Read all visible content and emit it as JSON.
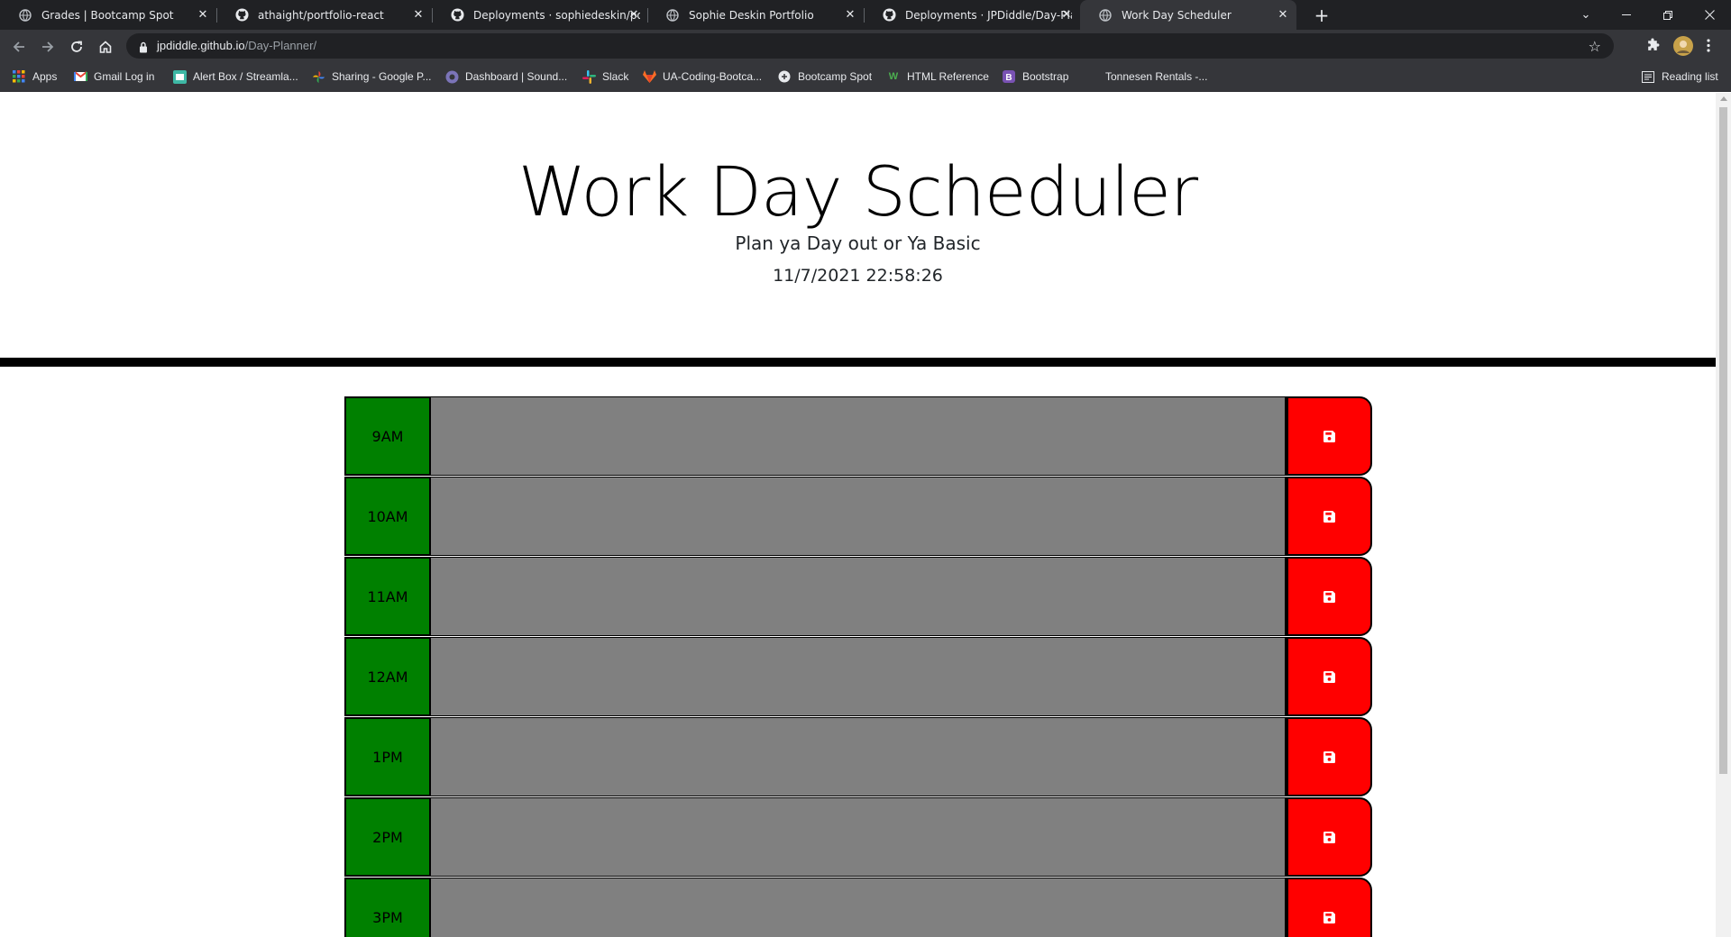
{
  "browser": {
    "tabs": [
      {
        "title": "Grades | Bootcamp Spot",
        "icon": "globe-icon"
      },
      {
        "title": "athaight/portfolio-react",
        "icon": "github-icon"
      },
      {
        "title": "Deployments · sophiedeskin/port",
        "icon": "github-icon"
      },
      {
        "title": "Sophie Deskin Portfolio",
        "icon": "globe-icon"
      },
      {
        "title": "Deployments · JPDiddle/Day-Plan",
        "icon": "github-icon"
      },
      {
        "title": "Work Day Scheduler",
        "icon": "globe-icon"
      }
    ],
    "active_tab": 5,
    "url_host": "jpdiddle.github.io",
    "url_path": "/Day-Planner/",
    "bookmarks": [
      {
        "label": "Apps",
        "icon": "apps-grid-icon"
      },
      {
        "label": "Gmail Log in",
        "icon": "gmail-icon"
      },
      {
        "label": "Alert Box / Streamla...",
        "icon": "alertbox-icon"
      },
      {
        "label": "Sharing - Google P...",
        "icon": "google-photos-icon"
      },
      {
        "label": "Dashboard | Sound...",
        "icon": "soundcloud-icon"
      },
      {
        "label": "Slack",
        "icon": "slack-icon"
      },
      {
        "label": "UA-Coding-Bootca...",
        "icon": "gitlab-icon"
      },
      {
        "label": "Bootcamp Spot",
        "icon": "globe-icon"
      },
      {
        "label": "HTML Reference",
        "icon": "w3-icon"
      },
      {
        "label": "Bootstrap",
        "icon": "bootstrap-icon"
      },
      {
        "label": "Tonnesen Rentals -...",
        "icon": "blank-icon"
      }
    ],
    "reading_list": "Reading list"
  },
  "page": {
    "title": "Work Day Scheduler",
    "tagline": "Plan ya Day out or Ya Basic",
    "datetime": "11/7/2021 22:58:26",
    "hours": [
      {
        "label": "9AM",
        "text": ""
      },
      {
        "label": "10AM",
        "text": ""
      },
      {
        "label": "11AM",
        "text": ""
      },
      {
        "label": "12AM",
        "text": ""
      },
      {
        "label": "1PM",
        "text": ""
      },
      {
        "label": "2PM",
        "text": ""
      },
      {
        "label": "3PM",
        "text": ""
      }
    ],
    "colors": {
      "hour_bg": "#008000",
      "desc_bg": "#808080",
      "save_bg": "#ff0000"
    }
  }
}
